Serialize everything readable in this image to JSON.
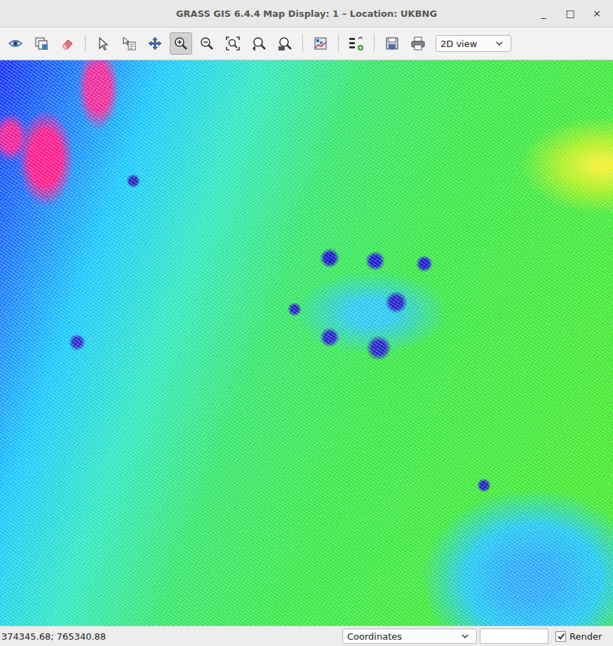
{
  "window": {
    "title": "GRASS GIS 6.4.4 Map Display: 1  – Location: UKBNG",
    "controls": [
      "_",
      "□",
      "×"
    ]
  },
  "toolbar": {
    "groups": [
      [
        {
          "selected": false
        },
        {
          "selected": false
        },
        {
          "selected": false
        }
      ],
      [
        {
          "selected": false
        },
        {
          "selected": false
        },
        {
          "selected": false
        },
        {
          "selected": true
        },
        {
          "selected": false
        },
        {
          "selected": false
        },
        {
          "selected": false
        },
        {
          "selected": false
        }
      ],
      [
        {
          "selected": false
        }
      ],
      [
        {
          "selected": false
        }
      ],
      [
        {
          "selected": false
        },
        {
          "selected": false
        }
      ]
    ],
    "view_select": {
      "value": "2D view"
    }
  },
  "status_bar": {
    "coordinates": "374345.68; 765340.88",
    "mode_select": {
      "value": "Coordinates"
    },
    "field": {
      "value": ""
    },
    "render": {
      "label": "Render",
      "checked": true
    }
  }
}
